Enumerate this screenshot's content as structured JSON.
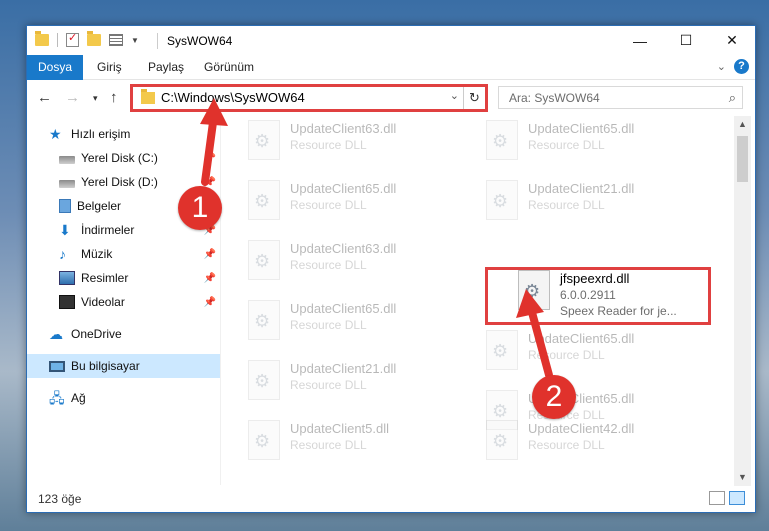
{
  "window": {
    "title": "SysWOW64",
    "controls": {
      "minimize": "—",
      "maximize": "☐",
      "close": "✕"
    }
  },
  "ribbon": {
    "tabs": [
      "Dosya",
      "Giriş",
      "Paylaş",
      "Görünüm"
    ]
  },
  "nav": {
    "address": "C:\\Windows\\SysWOW64",
    "search_placeholder": "Ara: SysWOW64"
  },
  "sidebar": {
    "items": [
      {
        "label": "Hızlı erişim",
        "icon": "star-icon"
      },
      {
        "label": "Yerel Disk (C:)",
        "icon": "drive-icon",
        "pinned": true
      },
      {
        "label": "Yerel Disk (D:)",
        "icon": "drive-icon",
        "pinned": true
      },
      {
        "label": "Belgeler",
        "icon": "documents-icon",
        "pinned": true
      },
      {
        "label": "İndirmeler",
        "icon": "download-icon",
        "pinned": true
      },
      {
        "label": "Müzik",
        "icon": "music-icon",
        "pinned": true
      },
      {
        "label": "Resimler",
        "icon": "pictures-icon",
        "pinned": true
      },
      {
        "label": "Videolar",
        "icon": "video-icon",
        "pinned": true
      },
      {
        "label": "OneDrive",
        "icon": "cloud-icon"
      },
      {
        "label": "Bu bilgisayar",
        "icon": "computer-icon",
        "selected": true
      },
      {
        "label": "Ağ",
        "icon": "network-icon"
      }
    ]
  },
  "files": [
    {
      "name": "UpdateClient63.dll",
      "meta1": "Resource DLL"
    },
    {
      "name": "UpdateClient65.dll",
      "meta1": "Resource DLL"
    },
    {
      "name": "UpdateClient65.dll",
      "meta1": "Resource DLL"
    },
    {
      "name": "UpdateClient21.dll",
      "meta1": "Resource DLL"
    },
    {
      "name": "UpdateClient63.dll",
      "meta1": "Resource DLL"
    },
    {
      "name": "jfspeexrd.dll",
      "meta1": "6.0.0.2911",
      "meta2": "Speex Reader for je...",
      "highlighted": true
    },
    {
      "name": "UpdateClient65.dll",
      "meta1": "Resource DLL"
    },
    {
      "name": "UpdateClient65.dll",
      "meta1": "Resource DLL"
    },
    {
      "name": "UpdateClient21.dll",
      "meta1": "Resource DLL"
    },
    {
      "name": "UpdateClient65.dll",
      "meta1": "Resource DLL"
    },
    {
      "name": "UpdateClient5.dll",
      "meta1": "Resource DLL"
    },
    {
      "name": "UpdateClient42.dll",
      "meta1": "Resource DLL"
    }
  ],
  "status": {
    "count": "123 öğe"
  },
  "annotations": {
    "badge1": "1",
    "badge2": "2",
    "accent": "#e0322c"
  }
}
